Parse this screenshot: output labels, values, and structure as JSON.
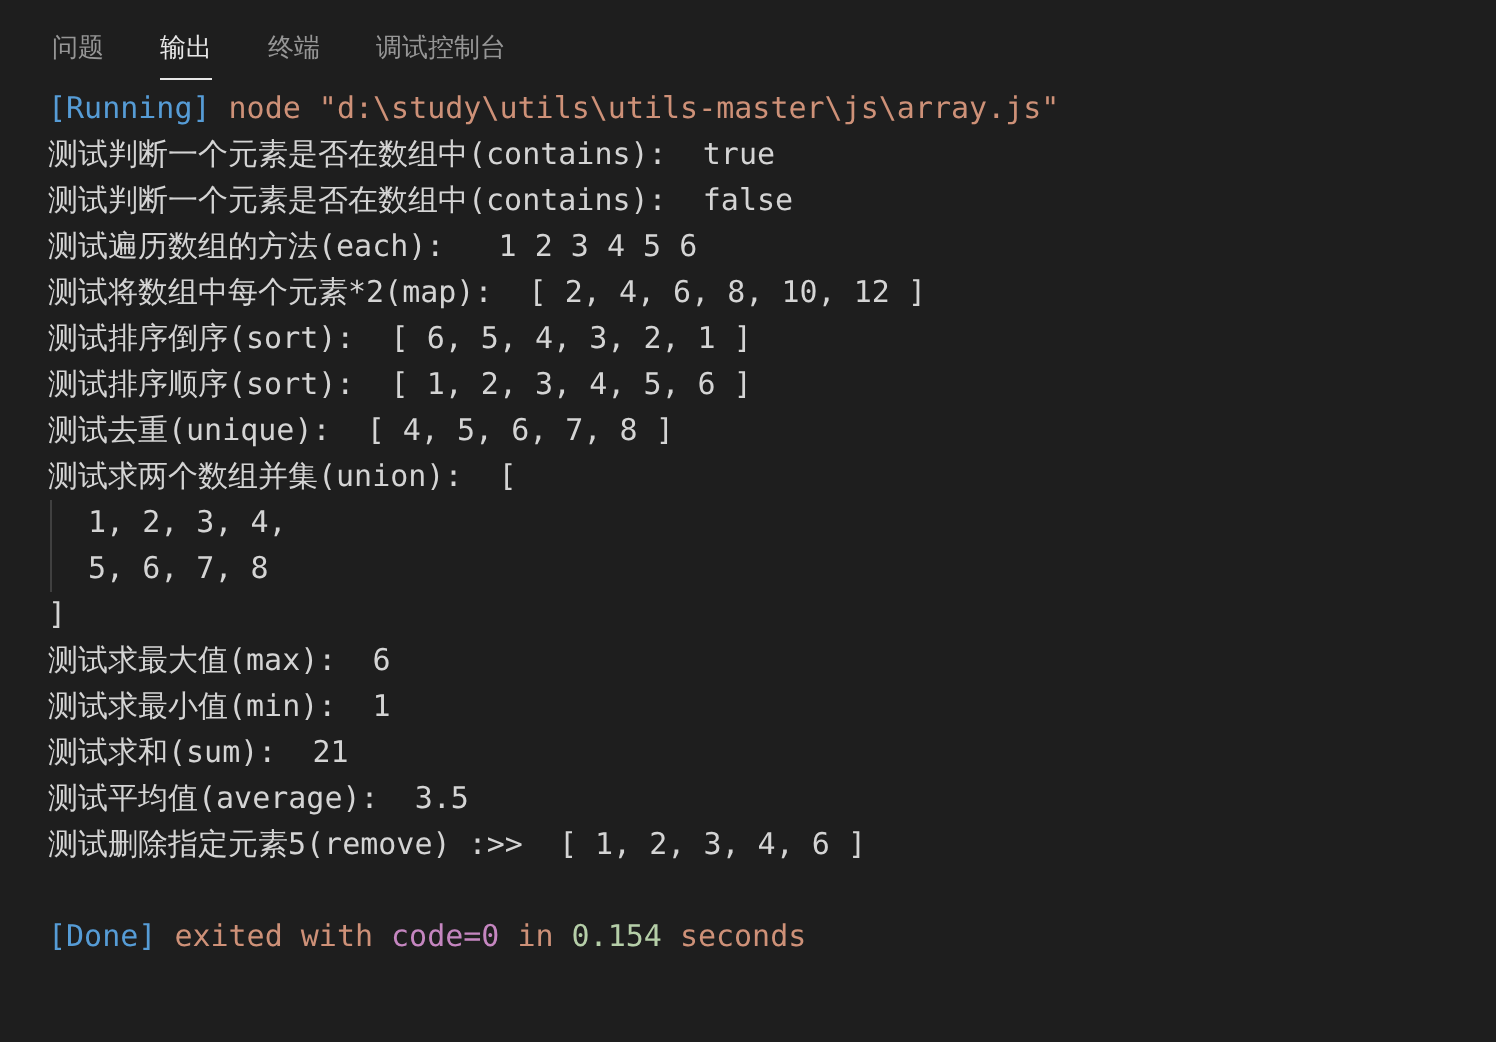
{
  "tabs": [
    {
      "label": "问题",
      "selected": false
    },
    {
      "label": "输出",
      "selected": true
    },
    {
      "label": "终端",
      "selected": false
    },
    {
      "label": "调试控制台",
      "selected": false
    }
  ],
  "output": [
    {
      "kind": "status",
      "segments": [
        {
          "text": "[Running]",
          "color": "#569cd6"
        },
        {
          "text": "node \"d:\\study\\utils\\utils-master\\js\\array.js\"",
          "color": "#ce9178"
        }
      ]
    },
    {
      "kind": "plain",
      "text": "测试判断一个元素是否在数组中(contains):  true"
    },
    {
      "kind": "plain",
      "text": "测试判断一个元素是否在数组中(contains):  false"
    },
    {
      "kind": "plain",
      "text": "测试遍历数组的方法(each):   1 2 3 4 5 6"
    },
    {
      "kind": "plain",
      "text": "测试将数组中每个元素*2(map):  [ 2, 4, 6, 8, 10, 12 ]"
    },
    {
      "kind": "plain",
      "text": "测试排序倒序(sort):  [ 6, 5, 4, 3, 2, 1 ]"
    },
    {
      "kind": "plain",
      "text": "测试排序顺序(sort):  [ 1, 2, 3, 4, 5, 6 ]"
    },
    {
      "kind": "plain",
      "text": "测试去重(unique):  [ 4, 5, 6, 7, 8 ]"
    },
    {
      "kind": "plain",
      "text": "测试求两个数组并集(union):  ["
    },
    {
      "kind": "indented",
      "lines": [
        "1, 2, 3, 4,",
        "5, 6, 7, 8"
      ]
    },
    {
      "kind": "plain",
      "text": "]"
    },
    {
      "kind": "plain",
      "text": "测试求最大值(max):  6"
    },
    {
      "kind": "plain",
      "text": "测试求最小值(min):  1"
    },
    {
      "kind": "plain",
      "text": "测试求和(sum):  21"
    },
    {
      "kind": "plain",
      "text": "测试平均值(average):  3.5"
    },
    {
      "kind": "plain",
      "text": "测试删除指定元素5(remove) :>>  [ 1, 2, 3, 4, 6 ]"
    },
    {
      "kind": "blank"
    },
    {
      "kind": "status",
      "segments": [
        {
          "text": "[Done]",
          "color": "#569cd6"
        },
        {
          "text": "exited with",
          "color": "#ce9178"
        },
        {
          "text": "code=0",
          "color": "#c586c0"
        },
        {
          "text": "in",
          "color": "#ce9178"
        },
        {
          "text": "0.154",
          "color": "#b5cea8"
        },
        {
          "text": "seconds",
          "color": "#ce9178"
        }
      ]
    }
  ]
}
